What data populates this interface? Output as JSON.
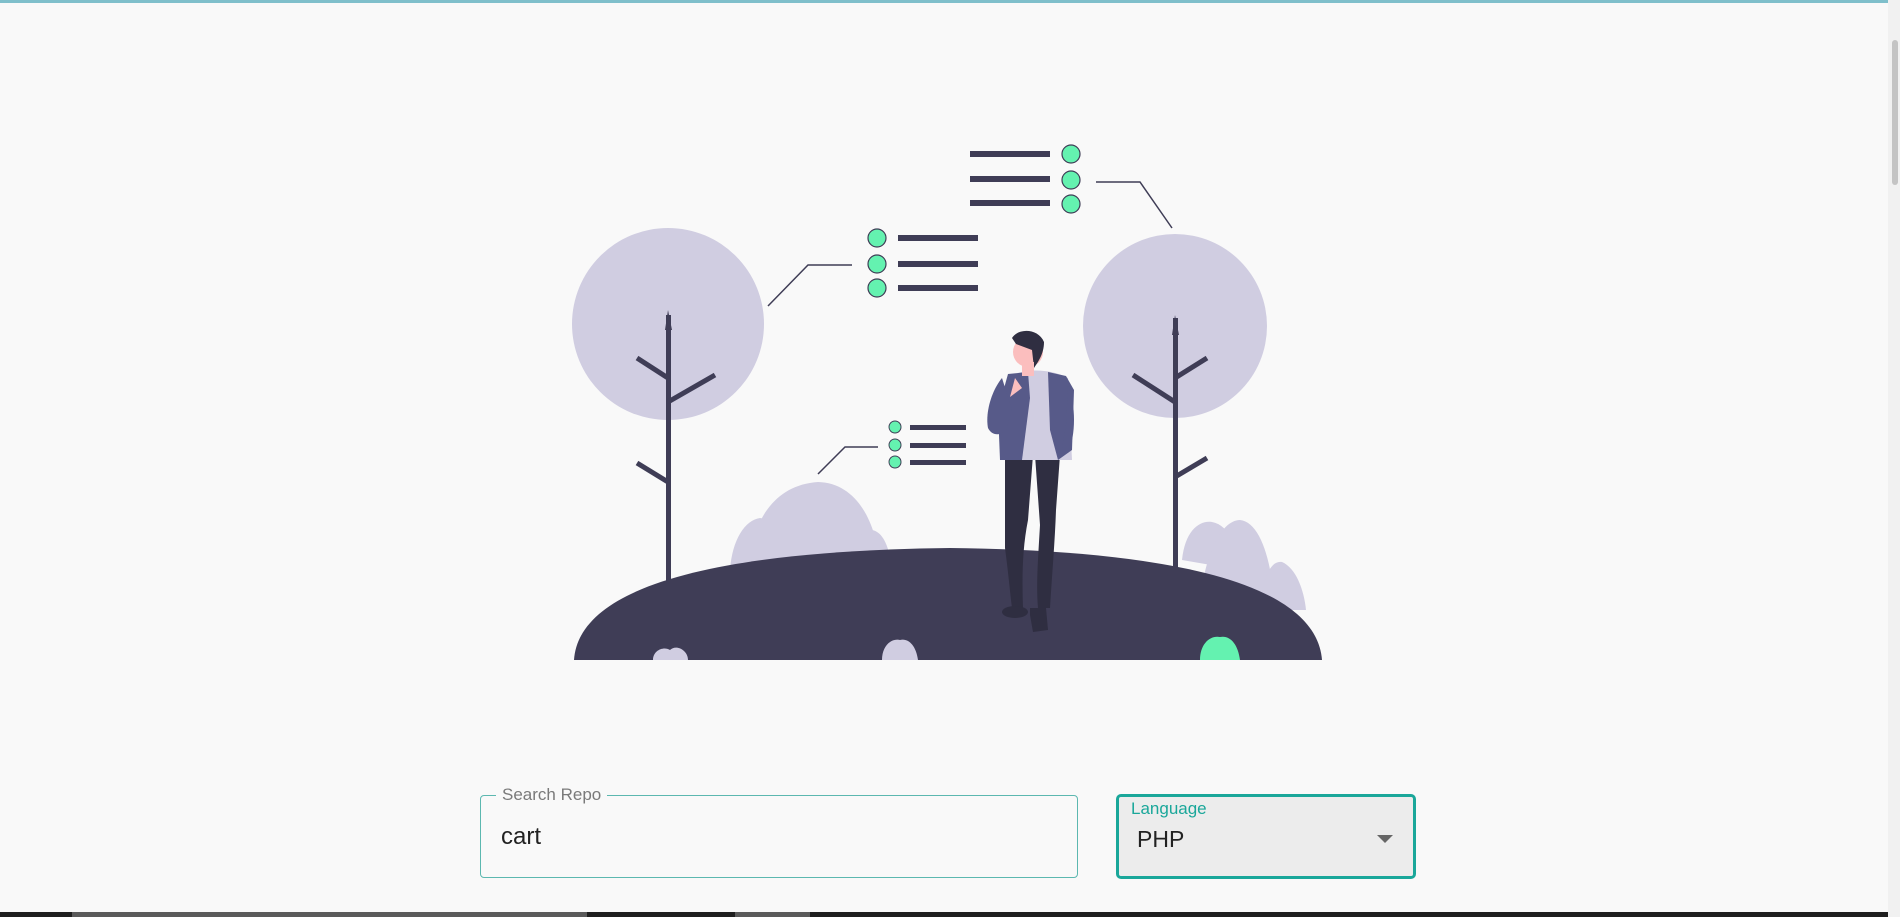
{
  "search": {
    "label": "Search Repo",
    "value": "cart"
  },
  "language": {
    "label": "Language",
    "selected": "PHP"
  },
  "colors": {
    "accent": "#1aa79a",
    "illustration_dark": "#3f3d56",
    "illustration_light": "#d0cde1",
    "illustration_green": "#64f2b0"
  },
  "icons": {
    "dropdown": "caret-down-icon",
    "illustration": "person-with-lists-illustration"
  }
}
